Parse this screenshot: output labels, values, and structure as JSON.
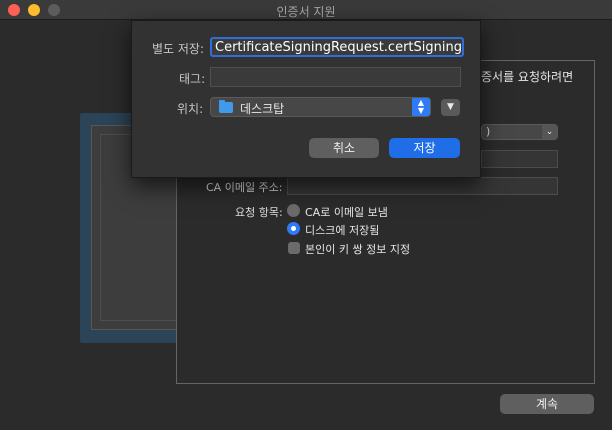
{
  "window": {
    "title": "인증서 지원"
  },
  "panel": {
    "partial_heading": "증서를 요청하려면",
    "partial_popup_value": ")",
    "ca_email_label": "CA 이메일 주소:",
    "request_label": "요청 항목:",
    "options": [
      {
        "label": "CA로 이메일 보냄",
        "selected": false
      },
      {
        "label": "디스크에 저장됨",
        "selected": true
      }
    ],
    "checkbox_label": "본인이 키 쌍 정보 지정",
    "checkbox_checked": false,
    "continue_label": "계속"
  },
  "save_sheet": {
    "save_as_label": "별도 저장:",
    "save_as_value": "CertificateSigningRequest.certSigningRe",
    "tags_label": "태그:",
    "where_label": "위치:",
    "where_value": "데스크탑",
    "cancel_label": "취소",
    "save_label": "저장",
    "accent_color": "#1f6ee8"
  },
  "icons": {
    "where_stepper": "up-down-chevron-icon",
    "expand": "chevron-down-icon",
    "folder": "folder-icon"
  }
}
